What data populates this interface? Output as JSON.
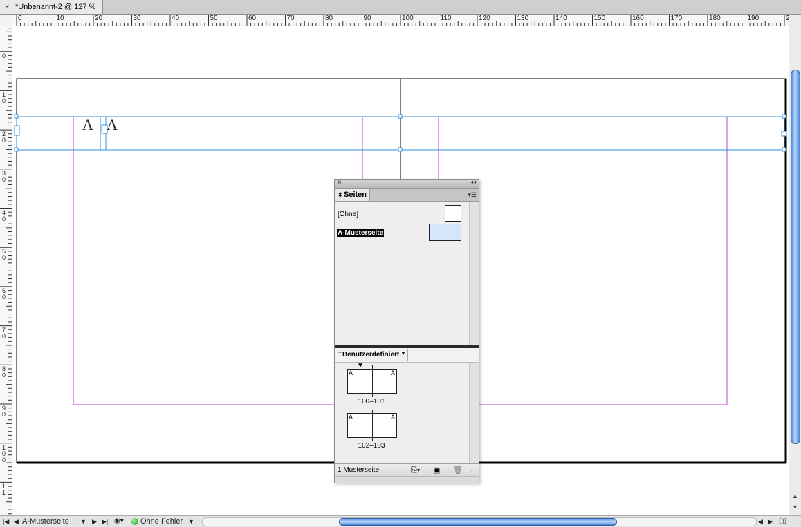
{
  "document": {
    "tab_title": "*Unbenannt-2 @ 127 %",
    "close_glyph": "×"
  },
  "rulers": {
    "horizontal": [
      "0",
      "10",
      "20",
      "30",
      "40",
      "50",
      "60",
      "70",
      "80",
      "90",
      "100",
      "110",
      "120",
      "130",
      "140",
      "150",
      "160",
      "170",
      "180",
      "190",
      "2"
    ],
    "vertical": [
      "1\n0",
      "0",
      "1\n0",
      "2\n0",
      "3\n0",
      "4\n0",
      "5\n0",
      "6\n0",
      "7\n0",
      "8\n0",
      "9\n0",
      "1\n0\n0",
      "1\n1"
    ]
  },
  "canvas": {
    "text_frame_glyphs": [
      "A",
      "A"
    ],
    "guide_color": "#c93fd6",
    "selection_color": "#2b8fe0"
  },
  "pages_panel": {
    "close_glyph": "×",
    "collapse_glyph": "◂◂",
    "tab_label": "Seiten",
    "tab_arrows": "⇕",
    "menu_glyph": "▾☰",
    "masters": [
      {
        "label": "[Ohne]",
        "selected": false
      },
      {
        "label": "A-Musterseite",
        "selected": true
      }
    ],
    "view_dropdown": "Benutzerdefiniert.",
    "spreads": [
      {
        "left_prefix": "A",
        "right_prefix": "A",
        "label": "100–101"
      },
      {
        "left_prefix": "A",
        "right_prefix": "A",
        "label": "102–103"
      }
    ],
    "footer_text": "1 Musterseite"
  },
  "statusbar": {
    "page_field": "A-Musterseite",
    "preflight_label": "Ohne Fehler",
    "preflight_status_color": "#1e9e1e"
  }
}
